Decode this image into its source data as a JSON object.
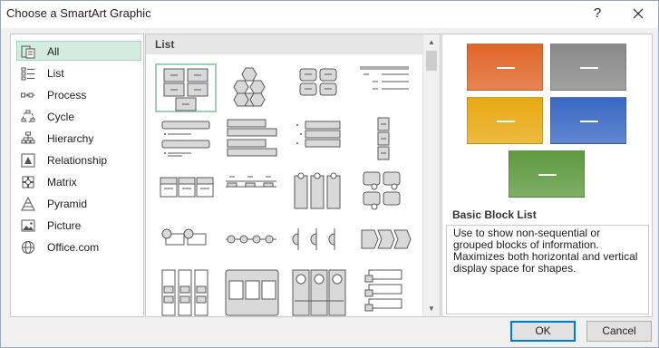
{
  "window": {
    "title": "Choose a SmartArt Graphic",
    "help_glyph": "?"
  },
  "categories": [
    {
      "label": "All",
      "icon": "all-layouts-icon",
      "selected": true
    },
    {
      "label": "List",
      "icon": "list-icon"
    },
    {
      "label": "Process",
      "icon": "process-icon"
    },
    {
      "label": "Cycle",
      "icon": "cycle-icon"
    },
    {
      "label": "Hierarchy",
      "icon": "hierarchy-icon"
    },
    {
      "label": "Relationship",
      "icon": "relationship-icon"
    },
    {
      "label": "Matrix",
      "icon": "matrix-icon"
    },
    {
      "label": "Pyramid",
      "icon": "pyramid-icon"
    },
    {
      "label": "Picture",
      "icon": "picture-icon"
    },
    {
      "label": "Office.com",
      "icon": "globe-icon"
    }
  ],
  "gallery": {
    "header": "List",
    "selected_layout": "basic-block-list"
  },
  "preview": {
    "title": "Basic Block List",
    "description": "Use to show non-sequential or grouped blocks of information. Maximizes both horizontal and vertical display space for shapes.",
    "colors": {
      "orange": "#e0662a",
      "gray": "#8a8a8a",
      "gold": "#e8a912",
      "blue": "#3a68c4",
      "green": "#5e9a3f"
    }
  },
  "buttons": {
    "ok": "OK",
    "cancel": "Cancel"
  }
}
